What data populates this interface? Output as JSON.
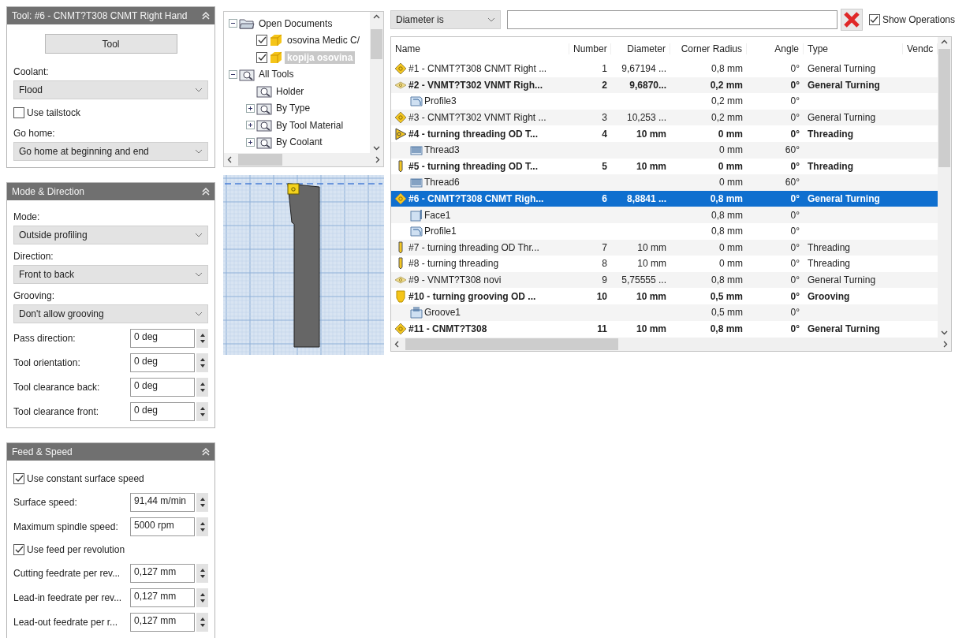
{
  "panels": [
    {
      "title": "Tool: #6 - CNMT?T308 CNMT Right Hand",
      "fields": [
        {
          "kind": "button",
          "label": "Tool"
        },
        {
          "kind": "label",
          "label": "Coolant:"
        },
        {
          "kind": "select",
          "value": "Flood"
        },
        {
          "kind": "checkbox",
          "label": "Use tailstock",
          "checked": false
        },
        {
          "kind": "label",
          "label": "Go home:"
        },
        {
          "kind": "select",
          "value": "Go home at beginning and end"
        }
      ]
    },
    {
      "title": "Mode & Direction",
      "fields": [
        {
          "kind": "label",
          "label": "Mode:"
        },
        {
          "kind": "select",
          "value": "Outside profiling"
        },
        {
          "kind": "label",
          "label": "Direction:"
        },
        {
          "kind": "select",
          "value": "Front to back"
        },
        {
          "kind": "label",
          "label": "Grooving:"
        },
        {
          "kind": "select",
          "value": "Don't allow grooving"
        },
        {
          "kind": "spinner",
          "label": "Pass direction:",
          "value": "0 deg"
        },
        {
          "kind": "spinner",
          "label": "Tool orientation:",
          "value": "0 deg"
        },
        {
          "kind": "spinner",
          "label": "Tool clearance back:",
          "value": "0 deg"
        },
        {
          "kind": "spinner",
          "label": "Tool clearance front:",
          "value": "0 deg"
        }
      ]
    },
    {
      "title": "Feed & Speed",
      "fields": [
        {
          "kind": "checkbox",
          "label": "Use constant surface speed",
          "checked": true
        },
        {
          "kind": "spinner",
          "label": "Surface speed:",
          "value": "91,44 m/min"
        },
        {
          "kind": "spinner",
          "label": "Maximum spindle speed:",
          "value": "5000 rpm"
        },
        {
          "kind": "checkbox",
          "label": "Use feed per revolution",
          "checked": true
        },
        {
          "kind": "spinner",
          "label": "Cutting feedrate per rev...",
          "value": "0,127 mm"
        },
        {
          "kind": "spinner",
          "label": "Lead-in feedrate per rev...",
          "value": "0,127 mm"
        },
        {
          "kind": "spinner",
          "label": "Lead-out feedrate per r...",
          "value": "0,127 mm"
        }
      ]
    }
  ],
  "tree": [
    {
      "label": "Open Documents",
      "kind": "documents",
      "expanded": true,
      "children": [
        {
          "label": "osovina Medic C/",
          "kind": "part",
          "checked": true,
          "selected": false
        },
        {
          "label": "kopija osovina",
          "kind": "part",
          "checked": true,
          "selected": true
        }
      ]
    },
    {
      "label": "All Tools",
      "kind": "library",
      "expanded": true,
      "children": [
        {
          "label": "Holder",
          "kind": "library"
        },
        {
          "label": "By Type",
          "kind": "library",
          "expanded": false
        },
        {
          "label": "By Tool Material",
          "kind": "library",
          "expanded": false
        },
        {
          "label": "By Coolant",
          "kind": "library",
          "expanded": false
        }
      ]
    }
  ],
  "filter": {
    "field": "Diameter is",
    "show_operations": {
      "label": "Show Operations",
      "checked": true
    }
  },
  "table": {
    "columns": [
      "Name",
      "Number",
      "Diameter",
      "Corner Radius",
      "Angle",
      "Type",
      "Vendc"
    ],
    "rows": [
      {
        "kind": "diamond",
        "bold": false,
        "selected": false,
        "cells": [
          "#1 - CNMT?T308 CNMT Right ...",
          "1",
          "9,67194 ...",
          "0,8 mm",
          "0°",
          "General Turning"
        ]
      },
      {
        "kind": "rhombus",
        "bold": true,
        "selected": false,
        "cells": [
          "#2 - VNMT?T302 VNMT Righ...",
          "2",
          "9,6870...",
          "0,2 mm",
          "0°",
          "General Turning"
        ]
      },
      {
        "kind": "profile",
        "bold": false,
        "selected": false,
        "cells": [
          "Profile3",
          null,
          null,
          "0,2 mm",
          "0°",
          null
        ]
      },
      {
        "kind": "diamond",
        "bold": false,
        "selected": false,
        "cells": [
          "#3 - CNMT?T302 VNMT Right ...",
          "3",
          "10,253 ...",
          "0,2 mm",
          "0°",
          "General Turning"
        ]
      },
      {
        "kind": "triangle",
        "bold": true,
        "selected": false,
        "cells": [
          "#4 - turning threading OD T...",
          "4",
          "10 mm",
          "0 mm",
          "0°",
          "Threading"
        ]
      },
      {
        "kind": "thread",
        "bold": false,
        "selected": false,
        "cells": [
          "Thread3",
          null,
          null,
          "0 mm",
          "60°",
          null
        ]
      },
      {
        "kind": "bar",
        "bold": true,
        "selected": false,
        "cells": [
          "#5 - turning threading OD T...",
          "5",
          "10 mm",
          "0 mm",
          "0°",
          "Threading"
        ]
      },
      {
        "kind": "thread",
        "bold": false,
        "selected": false,
        "cells": [
          "Thread6",
          null,
          null,
          "0 mm",
          "60°",
          null
        ]
      },
      {
        "kind": "diamond",
        "bold": true,
        "selected": true,
        "cells": [
          "#6 - CNMT?T308 CNMT Righ...",
          "6",
          "8,8841 ...",
          "0,8 mm",
          "0°",
          "General Turning"
        ]
      },
      {
        "kind": "face",
        "bold": false,
        "selected": false,
        "cells": [
          "Face1",
          null,
          null,
          "0,8 mm",
          "0°",
          null
        ]
      },
      {
        "kind": "profile",
        "bold": false,
        "selected": false,
        "cells": [
          "Profile1",
          null,
          null,
          "0,8 mm",
          "0°",
          null
        ]
      },
      {
        "kind": "bar",
        "bold": false,
        "selected": false,
        "cells": [
          "#7 - turning threading OD Thr...",
          "7",
          "10 mm",
          "0 mm",
          "0°",
          "Threading"
        ]
      },
      {
        "kind": "bar",
        "bold": false,
        "selected": false,
        "cells": [
          "#8 - turning threading",
          "8",
          "10 mm",
          "0 mm",
          "0°",
          "Threading"
        ]
      },
      {
        "kind": "rhombus",
        "bold": false,
        "selected": false,
        "cells": [
          "#9 - VNMT?T308 novi",
          "9",
          "5,75555 ...",
          "0,8 mm",
          "0°",
          "General Turning"
        ]
      },
      {
        "kind": "groove",
        "bold": true,
        "selected": false,
        "cells": [
          "#10 - turning grooving OD ...",
          "10",
          "10 mm",
          "0,5 mm",
          "0°",
          "Grooving"
        ]
      },
      {
        "kind": "groove_op",
        "bold": false,
        "selected": false,
        "cells": [
          "Groove1",
          null,
          null,
          "0,5 mm",
          "0°",
          null
        ]
      },
      {
        "kind": "diamond",
        "bold": true,
        "selected": false,
        "cells": [
          "#11 - CNMT?T308",
          "11",
          "10 mm",
          "0,8 mm",
          "0°",
          "General Turning"
        ]
      }
    ]
  }
}
